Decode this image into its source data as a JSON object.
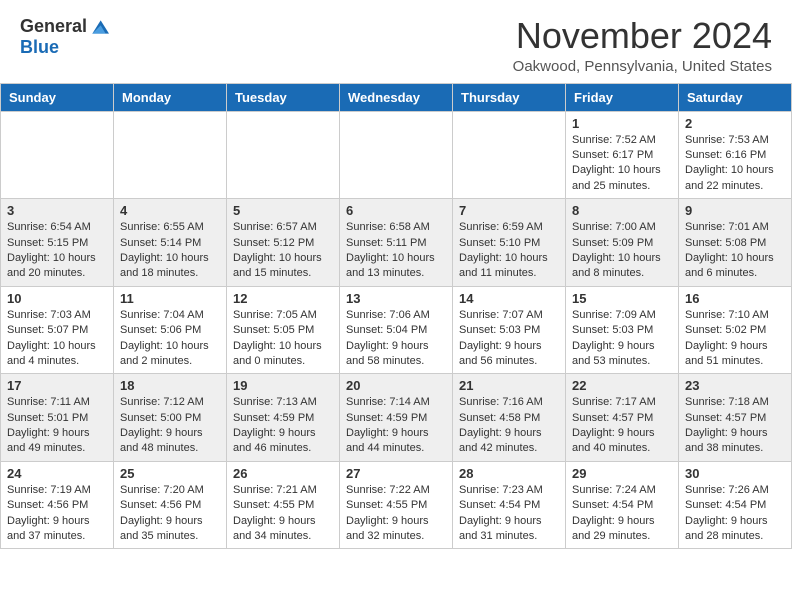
{
  "logo": {
    "general": "General",
    "blue": "Blue"
  },
  "header": {
    "month": "November 2024",
    "location": "Oakwood, Pennsylvania, United States"
  },
  "weekdays": [
    "Sunday",
    "Monday",
    "Tuesday",
    "Wednesday",
    "Thursday",
    "Friday",
    "Saturday"
  ],
  "weeks": [
    [
      {
        "day": "",
        "info": ""
      },
      {
        "day": "",
        "info": ""
      },
      {
        "day": "",
        "info": ""
      },
      {
        "day": "",
        "info": ""
      },
      {
        "day": "",
        "info": ""
      },
      {
        "day": "1",
        "info": "Sunrise: 7:52 AM\nSunset: 6:17 PM\nDaylight: 10 hours and 25 minutes."
      },
      {
        "day": "2",
        "info": "Sunrise: 7:53 AM\nSunset: 6:16 PM\nDaylight: 10 hours and 22 minutes."
      }
    ],
    [
      {
        "day": "3",
        "info": "Sunrise: 6:54 AM\nSunset: 5:15 PM\nDaylight: 10 hours and 20 minutes."
      },
      {
        "day": "4",
        "info": "Sunrise: 6:55 AM\nSunset: 5:14 PM\nDaylight: 10 hours and 18 minutes."
      },
      {
        "day": "5",
        "info": "Sunrise: 6:57 AM\nSunset: 5:12 PM\nDaylight: 10 hours and 15 minutes."
      },
      {
        "day": "6",
        "info": "Sunrise: 6:58 AM\nSunset: 5:11 PM\nDaylight: 10 hours and 13 minutes."
      },
      {
        "day": "7",
        "info": "Sunrise: 6:59 AM\nSunset: 5:10 PM\nDaylight: 10 hours and 11 minutes."
      },
      {
        "day": "8",
        "info": "Sunrise: 7:00 AM\nSunset: 5:09 PM\nDaylight: 10 hours and 8 minutes."
      },
      {
        "day": "9",
        "info": "Sunrise: 7:01 AM\nSunset: 5:08 PM\nDaylight: 10 hours and 6 minutes."
      }
    ],
    [
      {
        "day": "10",
        "info": "Sunrise: 7:03 AM\nSunset: 5:07 PM\nDaylight: 10 hours and 4 minutes."
      },
      {
        "day": "11",
        "info": "Sunrise: 7:04 AM\nSunset: 5:06 PM\nDaylight: 10 hours and 2 minutes."
      },
      {
        "day": "12",
        "info": "Sunrise: 7:05 AM\nSunset: 5:05 PM\nDaylight: 10 hours and 0 minutes."
      },
      {
        "day": "13",
        "info": "Sunrise: 7:06 AM\nSunset: 5:04 PM\nDaylight: 9 hours and 58 minutes."
      },
      {
        "day": "14",
        "info": "Sunrise: 7:07 AM\nSunset: 5:03 PM\nDaylight: 9 hours and 56 minutes."
      },
      {
        "day": "15",
        "info": "Sunrise: 7:09 AM\nSunset: 5:03 PM\nDaylight: 9 hours and 53 minutes."
      },
      {
        "day": "16",
        "info": "Sunrise: 7:10 AM\nSunset: 5:02 PM\nDaylight: 9 hours and 51 minutes."
      }
    ],
    [
      {
        "day": "17",
        "info": "Sunrise: 7:11 AM\nSunset: 5:01 PM\nDaylight: 9 hours and 49 minutes."
      },
      {
        "day": "18",
        "info": "Sunrise: 7:12 AM\nSunset: 5:00 PM\nDaylight: 9 hours and 48 minutes."
      },
      {
        "day": "19",
        "info": "Sunrise: 7:13 AM\nSunset: 4:59 PM\nDaylight: 9 hours and 46 minutes."
      },
      {
        "day": "20",
        "info": "Sunrise: 7:14 AM\nSunset: 4:59 PM\nDaylight: 9 hours and 44 minutes."
      },
      {
        "day": "21",
        "info": "Sunrise: 7:16 AM\nSunset: 4:58 PM\nDaylight: 9 hours and 42 minutes."
      },
      {
        "day": "22",
        "info": "Sunrise: 7:17 AM\nSunset: 4:57 PM\nDaylight: 9 hours and 40 minutes."
      },
      {
        "day": "23",
        "info": "Sunrise: 7:18 AM\nSunset: 4:57 PM\nDaylight: 9 hours and 38 minutes."
      }
    ],
    [
      {
        "day": "24",
        "info": "Sunrise: 7:19 AM\nSunset: 4:56 PM\nDaylight: 9 hours and 37 minutes."
      },
      {
        "day": "25",
        "info": "Sunrise: 7:20 AM\nSunset: 4:56 PM\nDaylight: 9 hours and 35 minutes."
      },
      {
        "day": "26",
        "info": "Sunrise: 7:21 AM\nSunset: 4:55 PM\nDaylight: 9 hours and 34 minutes."
      },
      {
        "day": "27",
        "info": "Sunrise: 7:22 AM\nSunset: 4:55 PM\nDaylight: 9 hours and 32 minutes."
      },
      {
        "day": "28",
        "info": "Sunrise: 7:23 AM\nSunset: 4:54 PM\nDaylight: 9 hours and 31 minutes."
      },
      {
        "day": "29",
        "info": "Sunrise: 7:24 AM\nSunset: 4:54 PM\nDaylight: 9 hours and 29 minutes."
      },
      {
        "day": "30",
        "info": "Sunrise: 7:26 AM\nSunset: 4:54 PM\nDaylight: 9 hours and 28 minutes."
      }
    ]
  ]
}
